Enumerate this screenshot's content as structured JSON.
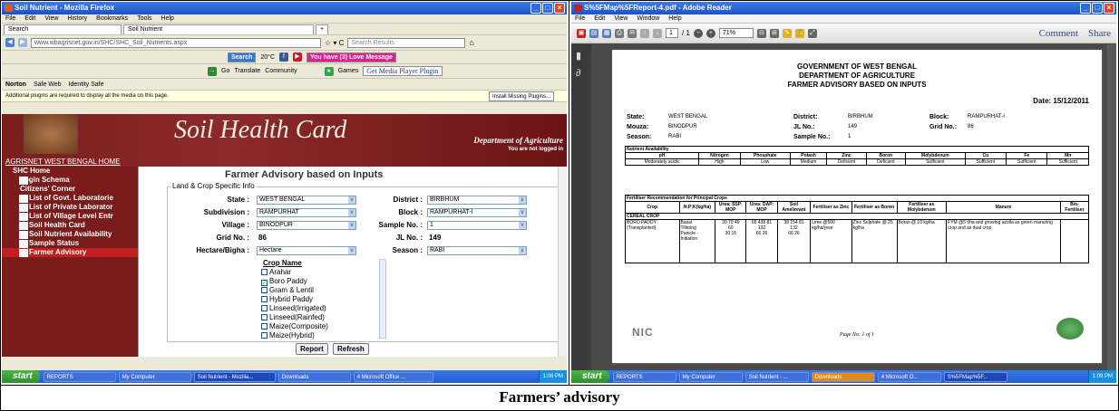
{
  "caption": "Farmers’ advisory",
  "firefox": {
    "title": "Soil Nutrient - Mozilla Firefox",
    "menu": [
      "File",
      "Edit",
      "View",
      "History",
      "Bookmarks",
      "Tools",
      "Help"
    ],
    "tabs": [
      "Search",
      "Soil Nutrient"
    ],
    "url": "www.wbagrisnet.gov.in/SHC/SHC_Soil_Nutrients.aspx",
    "search_placeholder": "Search Results",
    "search_btn": "Search",
    "temp": "20°C",
    "love_msg": "You have (3) Love Message",
    "go": "Go",
    "translate": "Translate",
    "community": "Community",
    "games": "Games",
    "media_plugin": "Get Media Player Plugin",
    "norton": "Norton",
    "safe_web": "Safe Web",
    "identity_safe": "Identity Safe",
    "plugin_notice": "Additional plugins are required to display all the media on this page.",
    "install_plugins": "Install Missing Plugins...",
    "banner_title": "Soil Health Card",
    "banner_dept": "Department of Agriculture",
    "banner_login": "You are not logged in",
    "home_link": "AGRISNET WEST BENGAL HOME",
    "sidebar": {
      "root": "SHC Home",
      "login": "Login Schema",
      "corner": "Citizens' Corner",
      "items": [
        "List of Govt. Laboratorie",
        "List of Private Laborator",
        "List of Village Level Entr",
        "Soil Health Card",
        "Soil Nutrient Availability",
        "Sample Status",
        "Farmer Advisory"
      ]
    },
    "form": {
      "heading": "Farmer Advisory based on Inputs",
      "legend": "Land & Crop Specific Info",
      "state_lbl": "State :",
      "state": "WEST BENGAL",
      "district_lbl": "District :",
      "district": "BIRBHUM",
      "subdivision_lbl": "Subdivision :",
      "subdivision": "RAMPURHAT",
      "block_lbl": "Block :",
      "block": "RAMPURHAT-I",
      "village_lbl": "Village :",
      "village": "BINODPUR",
      "sample_lbl": "Sample No. :",
      "sample": "1",
      "grid_lbl": "Grid No. :",
      "grid": "86",
      "jl_lbl": "JL No. :",
      "jl": "149",
      "hectare_lbl": "Hectare/Bigha :",
      "hectare": "Hectare",
      "season_lbl": "Season :",
      "season": "RABI",
      "crop_heading": "Crop Name",
      "crops": [
        "Arahar",
        "Boro Paddy",
        "Gram & Lentil",
        "Hybrid Paddy",
        "Linseed(Irrigated)",
        "Linseed(Rainfed)",
        "Maize(Composite)",
        "Maize(Hybrid)"
      ],
      "report_btn": "Report",
      "refresh_btn": "Refresh"
    },
    "taskbar": {
      "start": "start",
      "items": [
        "REPORTS",
        "My Computer",
        "Soil Nutrient - Mozilla...",
        "Downloads",
        "4 Microsoft Office ..."
      ],
      "time": "1:08 PM"
    }
  },
  "reader": {
    "title": "S%5FMap%5FReport-4.pdf - Adobe Reader",
    "menu": [
      "File",
      "Edit",
      "View",
      "Window",
      "Help"
    ],
    "page": "1",
    "page_total": "/ 1",
    "zoom": "71%",
    "comment": "Comment",
    "share": "Share",
    "doc": {
      "h1": "GOVERNMENT OF WEST BENGAL",
      "h2": "DEPARTMENT OF AGRICULTURE",
      "h3": "FARMER ADVISORY BASED ON INPUTS",
      "date": "Date: 15/12/2011",
      "state_lbl": "State:",
      "state": "WEST BENGAL",
      "district_lbl": "District:",
      "district": "BIRBHUM",
      "block_lbl": "Block:",
      "block": "RAMPURHAT-I",
      "mouza_lbl": "Mouza:",
      "mouza": "BINODPUR",
      "jl_lbl": "JL No.:",
      "jl": "149",
      "grid_lbl": "Grid No.:",
      "grid": "86",
      "season_lbl": "Season:",
      "season": "RABI",
      "sample_lbl": "Sample No.:",
      "sample": "1",
      "nutrient_title": "Nutrient Availability",
      "nutrient_headers": [
        "pH",
        "Nitrogen",
        "Phosphate",
        "Potash",
        "Zinc",
        "Boron",
        "Molybdenum",
        "Cu",
        "Fe",
        "Mn"
      ],
      "nutrient_values": [
        "Moderately acidic",
        "High",
        "Low",
        "Medium",
        "Deficient",
        "Deficient",
        "Sufficient",
        "Sufficient",
        "Sufficient",
        "Sufficient"
      ],
      "fert_title": "Fertiliser Recommendation for Principal Crops",
      "fert_headers": [
        "Crop",
        "N:P:K(kg/ha)",
        "Urea: SSP: MOP",
        "Urea: DAP: MOP",
        "Soil Ameliorant",
        "Fertiliser as Zinc",
        "Fertiliser as Boron",
        "Fertiliser as Molybdenum",
        "Manure",
        "Bio-Fertiliser"
      ],
      "cereal": "CEREAL CROP",
      "crop": "BORO PADDY (Transplanted)",
      "stages": [
        "Basal",
        "Tillering",
        "Panicle - Initiation"
      ],
      "npk": [
        "30  70  49",
        "60",
        "30  16"
      ],
      "ssp": [
        "66  438  81",
        "132",
        "66  26"
      ],
      "dap": [
        "38  154  81",
        "132",
        "66  26"
      ],
      "ameliorant": "Lime @500 kg/ha/year",
      "zinc": "Zinc Sulphate @ 25 kg/ha",
      "boron": "Borax @ 10 kg/ha",
      "manure": "FYM @5 t/ha and growing azolla as green manuring crop and as dual crop",
      "footer_logo": "NIC",
      "page_footer": "Page No: 1 of 1"
    },
    "taskbar": {
      "start": "start",
      "items": [
        "REPORTS",
        "My Computer",
        "Soil Nutrient - ...",
        "Downloads",
        "4 Microsoft O...",
        "S%5FMap%5F..."
      ],
      "time": "1:09 PM"
    }
  }
}
